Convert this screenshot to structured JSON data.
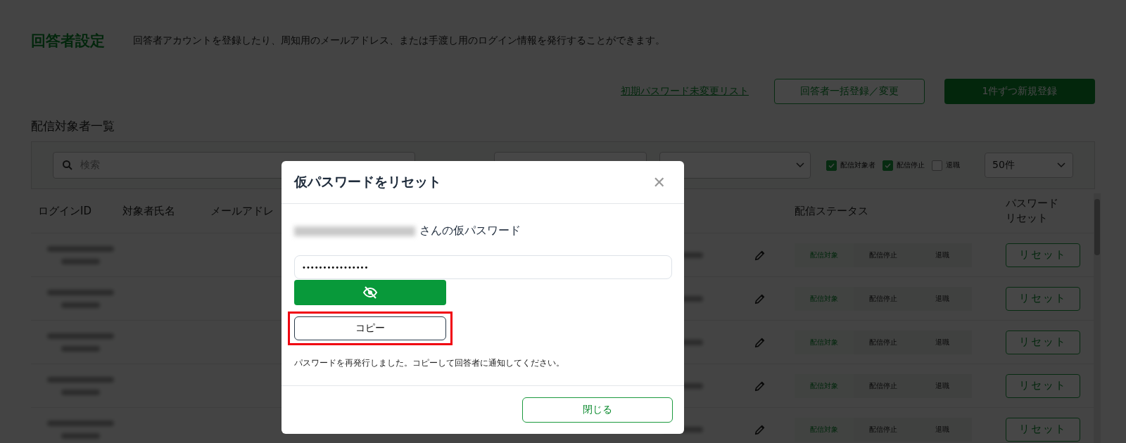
{
  "page": {
    "title": "回答者設定",
    "description": "回答者アカウントを登録したり、周知用のメールアドレス、または手渡し用のログイン情報を発行することができます。"
  },
  "actions": {
    "link": "初期パスワード未変更リスト",
    "bulk_button": "回答者一括登録／変更",
    "new_button": "1件ずつ新規登録"
  },
  "section_title": "配信対象者一覧",
  "filters": {
    "search_placeholder": "検索",
    "checkboxes": [
      {
        "label": "配信対象者",
        "checked": true
      },
      {
        "label": "配信停止",
        "checked": true
      },
      {
        "label": "退職",
        "checked": false
      }
    ],
    "page_size": "50件"
  },
  "table": {
    "columns": [
      "ログインID",
      "対象者氏名",
      "メールアドレ",
      "配信ステータス",
      "パスワードリセット"
    ],
    "rows": [
      {
        "statuses": [
          {
            "label": "配信対象",
            "selected": true
          },
          {
            "label": "配信停止",
            "selected": false
          },
          {
            "label": "退職",
            "selected": false
          }
        ],
        "reset": "リセット"
      },
      {
        "statuses": [
          {
            "label": "配信対象",
            "selected": true
          },
          {
            "label": "配信停止",
            "selected": false
          },
          {
            "label": "退職",
            "selected": false
          }
        ],
        "reset": "リセット"
      },
      {
        "statuses": [
          {
            "label": "配信対象",
            "selected": true
          },
          {
            "label": "配信停止",
            "selected": false
          },
          {
            "label": "退職",
            "selected": false
          }
        ],
        "reset": "リセット"
      },
      {
        "statuses": [
          {
            "label": "配信対象",
            "selected": true
          },
          {
            "label": "配信停止",
            "selected": false
          },
          {
            "label": "退職",
            "selected": false
          }
        ],
        "reset": "リセット"
      },
      {
        "statuses": [
          {
            "label": "配信対象",
            "selected": true
          },
          {
            "label": "配信停止",
            "selected": false
          },
          {
            "label": "退職",
            "selected": false
          }
        ],
        "reset": "リセット"
      }
    ]
  },
  "modal": {
    "title": "仮パスワードをリセット",
    "close": "✕",
    "name_suffix": "さんの仮パスワード",
    "password": "••••••••••••••••",
    "copy_button": {
      "label": "コピー",
      "highlighted": true
    },
    "note": "パスワードを再発行しました。コピーして回答者に通知してください。",
    "close_button": "閉じる"
  }
}
